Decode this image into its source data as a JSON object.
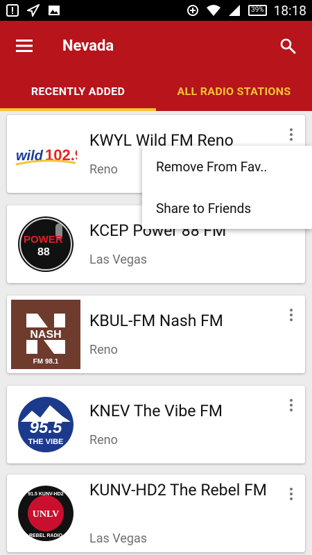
{
  "status_bar": {
    "time": "18:18",
    "battery": "39%",
    "left_icons": [
      "notification-alert-icon",
      "send-icon",
      "image-icon"
    ],
    "right_icons": [
      "data-saver-icon",
      "wifi-icon",
      "signal-icon",
      "battery-icon"
    ]
  },
  "toolbar": {
    "title": "Nevada",
    "menu_icon": "hamburger-menu-icon",
    "search_icon": "search-icon",
    "background_color": "#b7141b"
  },
  "tabs": [
    {
      "label": "RECENTLY ADDED",
      "active": true
    },
    {
      "label": "ALL RADIO STATIONS",
      "active": false
    }
  ],
  "tab_indicator_color": "#f6c533",
  "stations": [
    {
      "name": "KWYL Wild FM Reno",
      "city": "Reno",
      "logo": "Wild 102.9 logo",
      "logo_text": "wild 102.9"
    },
    {
      "name": "KCEP Power 88 FM",
      "city": "Las Vegas",
      "logo": "Power 88 logo",
      "logo_text": "POWER 88"
    },
    {
      "name": "KBUL-FM Nash FM",
      "city": "Reno",
      "logo": "Nash FM 98.1 logo",
      "logo_text": "NASH",
      "logo_sub": "FM 98.1"
    },
    {
      "name": "KNEV The Vibe FM",
      "city": "Reno",
      "logo": "95.5 The Vibe logo",
      "logo_text": "95.5",
      "logo_sub": "THE VIBE"
    },
    {
      "name": "KUNV-HD2 The Rebel FM",
      "city": "Las Vegas",
      "logo": "UNLV Rebel Radio logo",
      "logo_text": "UNLV",
      "logo_sub": "REBEL RADIO"
    }
  ],
  "popup_menu": {
    "items": [
      "Remove From Fav..",
      "Share to Friends"
    ]
  }
}
